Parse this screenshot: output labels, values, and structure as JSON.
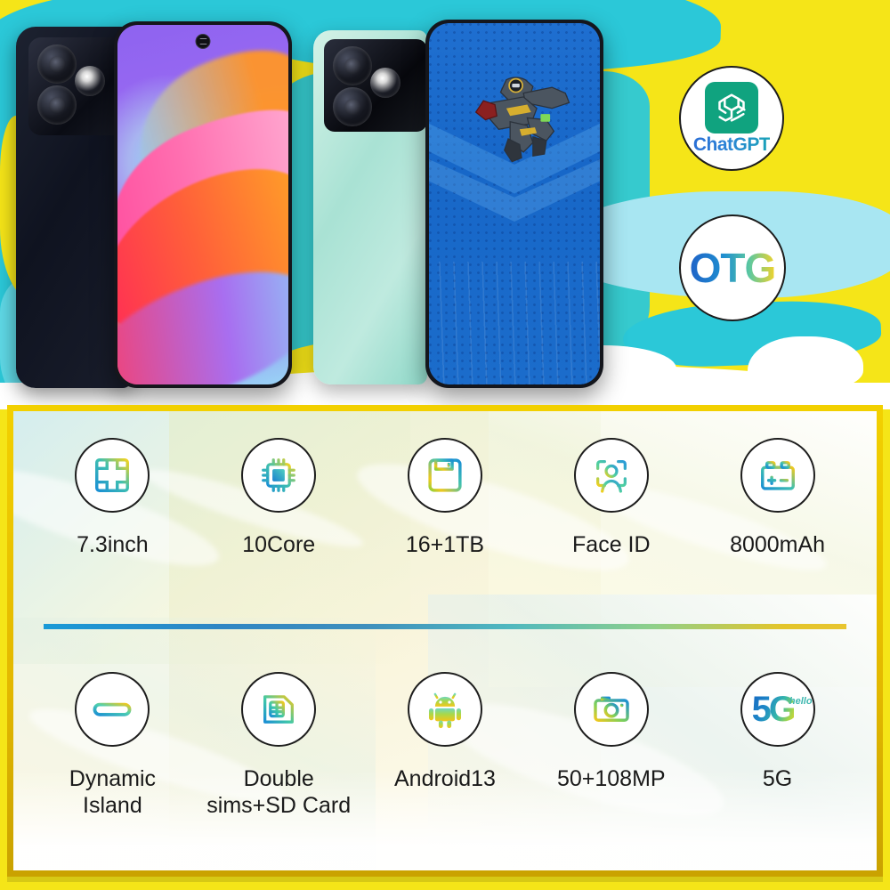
{
  "hero": {
    "colors": {
      "yellow": "#f5e518",
      "cyan": "#2bc8d8",
      "light_cyan": "#a8e6f2",
      "white": "#ffffff"
    },
    "phones": [
      {
        "name": "black-phone-back",
        "finish": "black",
        "camera_lenses": 3
      },
      {
        "name": "black-phone-front",
        "wallpaper": "purple-pink-orange-wave"
      },
      {
        "name": "mint-phone-back",
        "finish": "mint-green",
        "camera_lenses": 3
      },
      {
        "name": "mint-phone-front",
        "wallpaper": "blue-gaming-robot"
      }
    ],
    "badges": [
      {
        "id": "chatgpt",
        "label": "ChatGPT",
        "icon": "openai-logo-icon",
        "tile_color": "#10a37f"
      },
      {
        "id": "otg",
        "label": "OTG",
        "icon": "otg-text-icon"
      }
    ]
  },
  "panel": {
    "border_color": "#e3b800",
    "background_color": "#fdfbef",
    "divider_gradient": [
      "#1a9ad7",
      "#e8c530"
    ],
    "rows": [
      {
        "features": [
          {
            "icon": "screen-size-icon",
            "label": "7.3inch"
          },
          {
            "icon": "cpu-chip-icon",
            "label": "10Core"
          },
          {
            "icon": "floppy-storage-icon",
            "label": "16+1TB"
          },
          {
            "icon": "face-id-icon",
            "label": "Face ID"
          },
          {
            "icon": "battery-icon",
            "label": "8000mAh"
          }
        ]
      },
      {
        "features": [
          {
            "icon": "dynamic-island-icon",
            "label": "Dynamic\nIsland"
          },
          {
            "icon": "sim-card-icon",
            "label": "Double\nsims+SD Card"
          },
          {
            "icon": "android-robot-icon",
            "label": "Android13"
          },
          {
            "icon": "camera-icon",
            "label": "50+108MP"
          },
          {
            "icon": "five-g-icon",
            "label": "5G",
            "badge_text": "5G",
            "badge_sub": "hello"
          }
        ]
      }
    ]
  }
}
